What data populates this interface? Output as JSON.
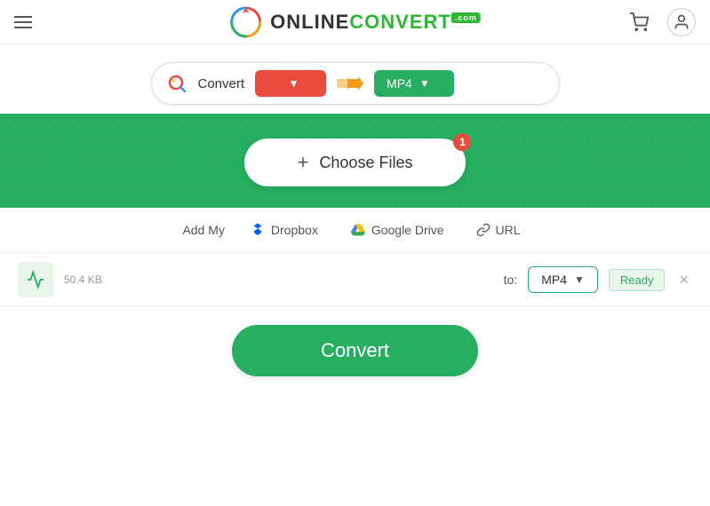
{
  "header": {
    "hamburger_label": "menu",
    "logo_online": "ONLINE",
    "logo_convert": "CONVERT",
    "logo_com": ".com",
    "cart_icon": "🛒",
    "user_icon": "👤"
  },
  "search": {
    "convert_label": "Convert",
    "from_format": "",
    "from_placeholder": "",
    "to_format": "MP4",
    "arrows": "⟫"
  },
  "upload": {
    "choose_files_label": "Choose Files",
    "notification_count": "1",
    "add_my_label": "Add My",
    "dropbox_label": "Dropbox",
    "gdrive_label": "Google Drive",
    "url_label": "URL"
  },
  "file_row": {
    "file_size": "50.4 KB",
    "to_label": "to:",
    "format": "MP4",
    "ready_label": "Ready",
    "remove_label": "×"
  },
  "convert": {
    "button_label": "Convert"
  }
}
